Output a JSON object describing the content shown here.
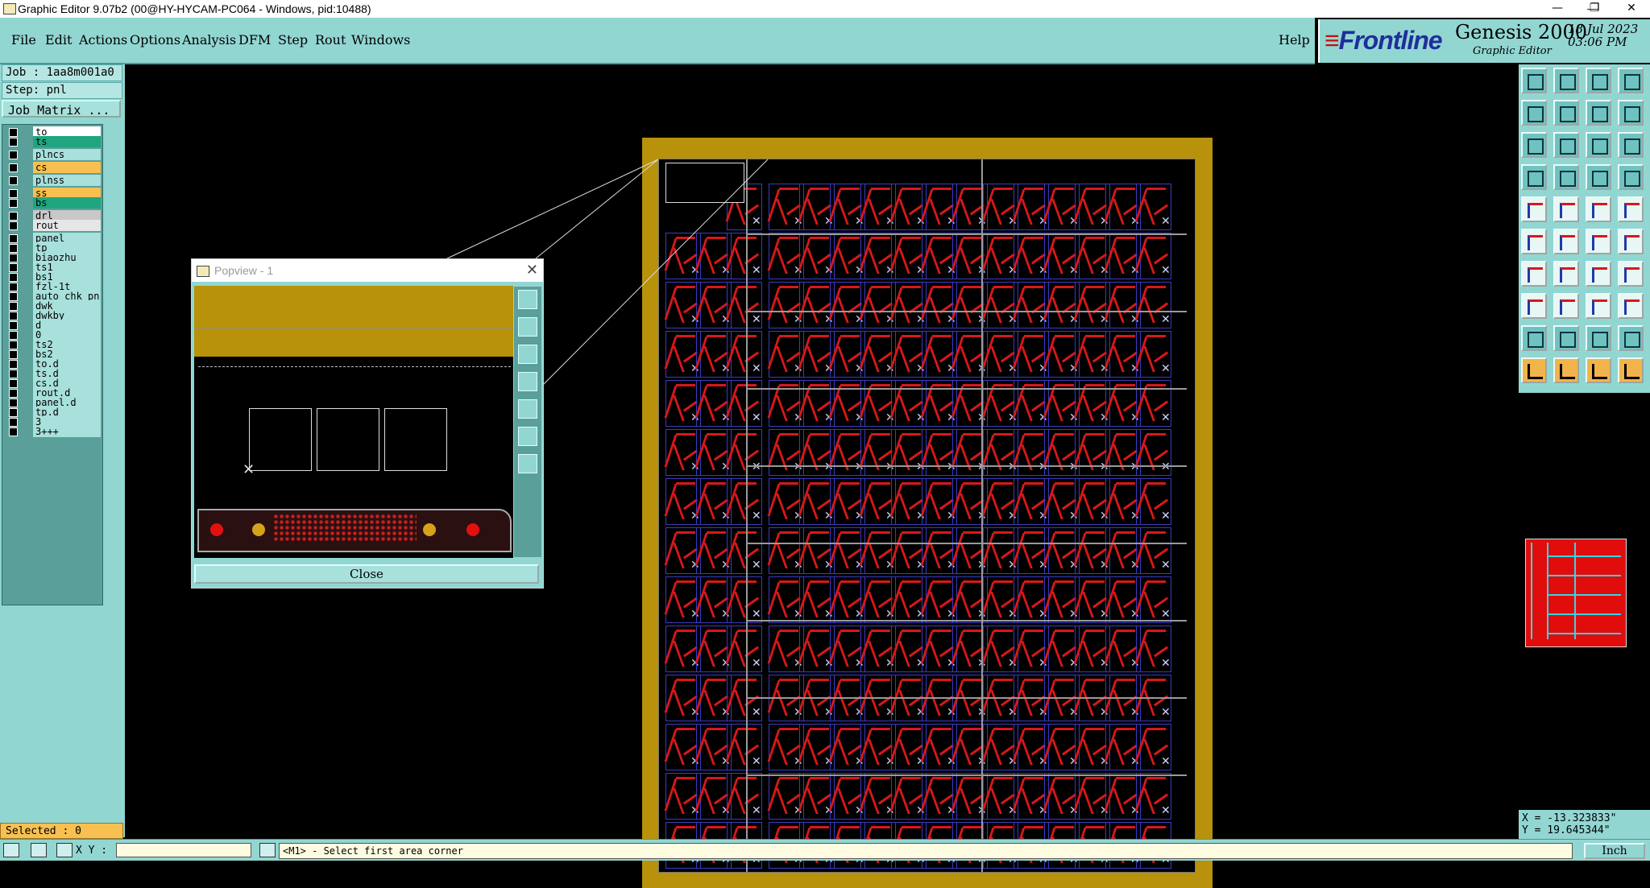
{
  "window": {
    "title": "Graphic Editor 9.07b2 (00@HY-HYCAM-PC064 - Windows, pid:10488)",
    "minimize_glyph": "—",
    "restore_glyph": "❐",
    "close_glyph": "✕"
  },
  "menu": {
    "items": [
      "File",
      "Edit",
      "Actions",
      "Options",
      "Analysis",
      "DFM",
      "Step",
      "Rout",
      "Windows"
    ],
    "help": "Help"
  },
  "brand": {
    "logo": "Frontline",
    "title": "Genesis 2000",
    "subtitle": "Graphic Editor",
    "date": "18 Jul 2023",
    "time": "03:06 PM"
  },
  "job": {
    "job_line": "Job : 1aa8m001a0",
    "step_line": "Step: pnl",
    "matrix_button": "Job Matrix ..."
  },
  "layers": [
    {
      "name": "to",
      "color": "#ffffff"
    },
    {
      "name": "ts",
      "color": "#1fa57f"
    },
    {
      "name": "plncs",
      "color": "#a8e0dc"
    },
    {
      "name": "cs",
      "color": "#f7c050"
    },
    {
      "name": "plnss",
      "color": "#a8e0dc"
    },
    {
      "name": "ss",
      "color": "#f7c050"
    },
    {
      "name": "bs",
      "color": "#1fa57f"
    },
    {
      "name": "drl",
      "color": "#c8c8c8"
    },
    {
      "name": "rout",
      "color": "#e6e6e6"
    },
    {
      "name": "panel",
      "color": "#a8e0dc"
    },
    {
      "name": "tp",
      "color": "#a8e0dc"
    },
    {
      "name": "biaozhu",
      "color": "#a8e0dc"
    },
    {
      "name": "ts1",
      "color": "#a8e0dc"
    },
    {
      "name": "bs1",
      "color": "#a8e0dc"
    },
    {
      "name": "fzl-1t",
      "color": "#a8e0dc"
    },
    {
      "name": "auto_chk_pn",
      "color": "#a8e0dc"
    },
    {
      "name": "dwk",
      "color": "#a8e0dc"
    },
    {
      "name": "dwkby",
      "color": "#a8e0dc"
    },
    {
      "name": "d",
      "color": "#a8e0dc"
    },
    {
      "name": "0",
      "color": "#a8e0dc"
    },
    {
      "name": "ts2",
      "color": "#a8e0dc"
    },
    {
      "name": "bs2",
      "color": "#a8e0dc"
    },
    {
      "name": "to.d",
      "color": "#a8e0dc"
    },
    {
      "name": "ts.d",
      "color": "#a8e0dc"
    },
    {
      "name": "cs.d",
      "color": "#a8e0dc"
    },
    {
      "name": "rout.d",
      "color": "#a8e0dc"
    },
    {
      "name": "panel.d",
      "color": "#a8e0dc"
    },
    {
      "name": "tp.d",
      "color": "#a8e0dc"
    },
    {
      "name": "3",
      "color": "#a8e0dc"
    },
    {
      "name": "3+++",
      "color": "#a8e0dc"
    }
  ],
  "status": {
    "selected": "Selected : 0",
    "xy_label": "X Y :",
    "prompt": "<M1> - Select first area corner",
    "unit": "Inch"
  },
  "popview": {
    "title": "Popview - 1",
    "close": "Close"
  },
  "coords": {
    "x": "X = -13.323833\"",
    "y": "Y = 19.645344\""
  },
  "colors": {
    "panel_bg": "#92d6d2",
    "board_gold": "#b8920a",
    "trace_red": "#d81818"
  }
}
